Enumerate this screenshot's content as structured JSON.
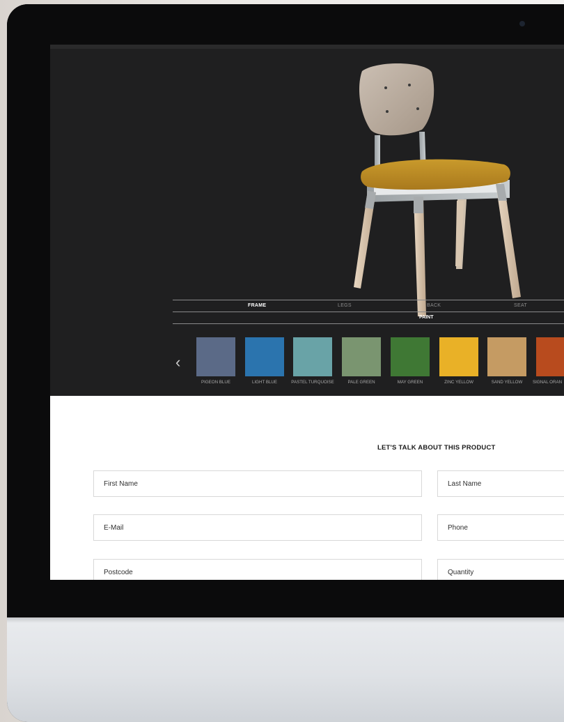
{
  "configurator": {
    "tabs": [
      {
        "label": "FRAME",
        "active": true
      },
      {
        "label": "LEGS",
        "active": false
      },
      {
        "label": "BACK",
        "active": false
      },
      {
        "label": "SEAT",
        "active": false
      }
    ],
    "sub_tab": "PAINT",
    "swatches": [
      {
        "name": "PIGEON BLUE",
        "color": "#5b6a87"
      },
      {
        "name": "LIGHT BLUE",
        "color": "#2b74ae"
      },
      {
        "name": "PASTEL TURQUOISE",
        "color": "#69a3a7"
      },
      {
        "name": "PALE GREEN",
        "color": "#7a9570"
      },
      {
        "name": "MAY GREEN",
        "color": "#3f7834"
      },
      {
        "name": "ZINC YELLOW",
        "color": "#e9b127"
      },
      {
        "name": "SAND YELLOW",
        "color": "#c59b63"
      },
      {
        "name": "SIGNAL ORAN",
        "color": "#b84b1e"
      }
    ]
  },
  "form": {
    "title": "LET'S TALK ABOUT THIS PRODUCT",
    "fields": {
      "first_name": "First Name",
      "last_name": "Last Name",
      "email": "E-Mail",
      "phone": "Phone",
      "postcode": "Postcode",
      "quantity": "Quantity"
    }
  }
}
